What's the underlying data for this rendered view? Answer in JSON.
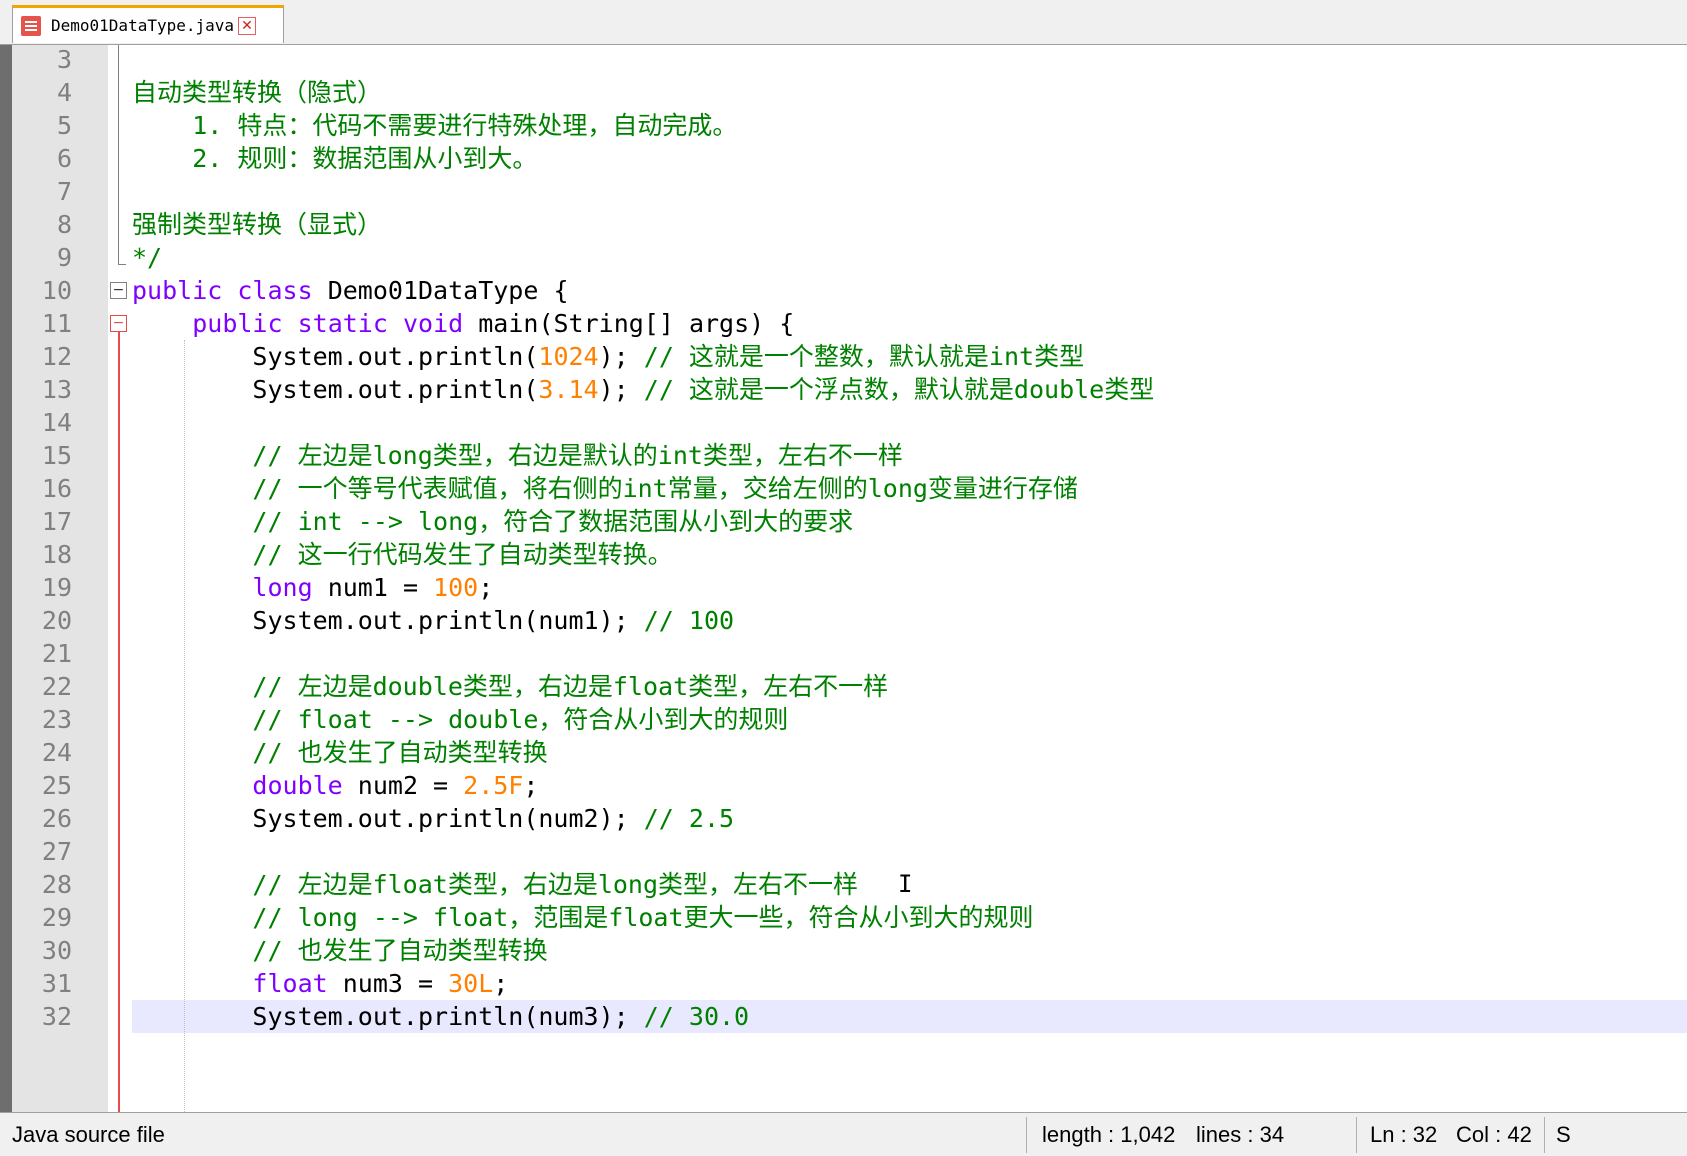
{
  "tab": {
    "filename": "Demo01DataType.java"
  },
  "colors": {
    "keyword": "#8000ff",
    "number": "#ff8000",
    "comment": "#008000",
    "line_number": "#808080",
    "current_line": "#e8e8ff",
    "fold_marker": "#e54c4c",
    "tab_accent": "#f2a500"
  },
  "editor": {
    "lines": [
      {
        "n": "3",
        "tokens": []
      },
      {
        "n": "4",
        "tokens": [
          {
            "t": "cm",
            "v": "自动类型转换（隐式）"
          }
        ]
      },
      {
        "n": "5",
        "tokens": [
          {
            "t": "cm",
            "v": "    1. 特点：代码不需要进行特殊处理，自动完成。"
          }
        ]
      },
      {
        "n": "6",
        "tokens": [
          {
            "t": "cm",
            "v": "    2. 规则：数据范围从小到大。"
          }
        ]
      },
      {
        "n": "7",
        "tokens": []
      },
      {
        "n": "8",
        "tokens": [
          {
            "t": "cm",
            "v": "强制类型转换（显式）"
          }
        ]
      },
      {
        "n": "9",
        "tokens": [
          {
            "t": "cm",
            "v": "*/"
          }
        ]
      },
      {
        "n": "10",
        "tokens": [
          {
            "t": "kw",
            "v": "public"
          },
          {
            "t": "tx",
            "v": " "
          },
          {
            "t": "kw",
            "v": "class"
          },
          {
            "t": "tx",
            "v": " Demo01DataType {"
          }
        ]
      },
      {
        "n": "11",
        "tokens": [
          {
            "t": "tx",
            "v": "    "
          },
          {
            "t": "kw",
            "v": "public"
          },
          {
            "t": "tx",
            "v": " "
          },
          {
            "t": "kw",
            "v": "static"
          },
          {
            "t": "tx",
            "v": " "
          },
          {
            "t": "kw",
            "v": "void"
          },
          {
            "t": "tx",
            "v": " main(String[] args) {"
          }
        ]
      },
      {
        "n": "12",
        "tokens": [
          {
            "t": "tx",
            "v": "        System.out.println("
          },
          {
            "t": "num",
            "v": "1024"
          },
          {
            "t": "tx",
            "v": "); "
          },
          {
            "t": "cm",
            "v": "// 这就是一个整数，默认就是int类型"
          }
        ]
      },
      {
        "n": "13",
        "tokens": [
          {
            "t": "tx",
            "v": "        System.out.println("
          },
          {
            "t": "num",
            "v": "3.14"
          },
          {
            "t": "tx",
            "v": "); "
          },
          {
            "t": "cm",
            "v": "// 这就是一个浮点数，默认就是double类型"
          }
        ]
      },
      {
        "n": "14",
        "tokens": []
      },
      {
        "n": "15",
        "tokens": [
          {
            "t": "cm",
            "v": "        // 左边是long类型，右边是默认的int类型，左右不一样"
          }
        ]
      },
      {
        "n": "16",
        "tokens": [
          {
            "t": "cm",
            "v": "        // 一个等号代表赋值，将右侧的int常量，交给左侧的long变量进行存储"
          }
        ]
      },
      {
        "n": "17",
        "tokens": [
          {
            "t": "cm",
            "v": "        // int --> long，符合了数据范围从小到大的要求"
          }
        ]
      },
      {
        "n": "18",
        "tokens": [
          {
            "t": "cm",
            "v": "        // 这一行代码发生了自动类型转换。"
          }
        ]
      },
      {
        "n": "19",
        "tokens": [
          {
            "t": "tx",
            "v": "        "
          },
          {
            "t": "kw",
            "v": "long"
          },
          {
            "t": "tx",
            "v": " num1 = "
          },
          {
            "t": "num",
            "v": "100"
          },
          {
            "t": "tx",
            "v": ";"
          }
        ]
      },
      {
        "n": "20",
        "tokens": [
          {
            "t": "tx",
            "v": "        System.out.println(num1); "
          },
          {
            "t": "cm",
            "v": "// 100"
          }
        ]
      },
      {
        "n": "21",
        "tokens": []
      },
      {
        "n": "22",
        "tokens": [
          {
            "t": "cm",
            "v": "        // 左边是double类型，右边是float类型，左右不一样"
          }
        ]
      },
      {
        "n": "23",
        "tokens": [
          {
            "t": "cm",
            "v": "        // float --> double，符合从小到大的规则"
          }
        ]
      },
      {
        "n": "24",
        "tokens": [
          {
            "t": "cm",
            "v": "        // 也发生了自动类型转换"
          }
        ]
      },
      {
        "n": "25",
        "tokens": [
          {
            "t": "tx",
            "v": "        "
          },
          {
            "t": "kw",
            "v": "double"
          },
          {
            "t": "tx",
            "v": " num2 = "
          },
          {
            "t": "num",
            "v": "2.5F"
          },
          {
            "t": "tx",
            "v": ";"
          }
        ]
      },
      {
        "n": "26",
        "tokens": [
          {
            "t": "tx",
            "v": "        System.out.println(num2); "
          },
          {
            "t": "cm",
            "v": "// 2.5"
          }
        ]
      },
      {
        "n": "27",
        "tokens": []
      },
      {
        "n": "28",
        "tokens": [
          {
            "t": "cm",
            "v": "        // 左边是float类型，右边是long类型，左右不一样"
          }
        ]
      },
      {
        "n": "29",
        "tokens": [
          {
            "t": "cm",
            "v": "        // long --> float，范围是float更大一些，符合从小到大的规则"
          }
        ]
      },
      {
        "n": "30",
        "tokens": [
          {
            "t": "cm",
            "v": "        // 也发生了自动类型转换"
          }
        ]
      },
      {
        "n": "31",
        "tokens": [
          {
            "t": "tx",
            "v": "        "
          },
          {
            "t": "kw",
            "v": "float"
          },
          {
            "t": "tx",
            "v": " num3 = "
          },
          {
            "t": "num",
            "v": "30L"
          },
          {
            "t": "tx",
            "v": ";"
          }
        ]
      },
      {
        "n": "32",
        "tokens": [
          {
            "t": "tx",
            "v": "        System.out.println(num3); "
          },
          {
            "t": "cm",
            "v": "// 30.0"
          }
        ],
        "current": true
      }
    ]
  },
  "statusbar": {
    "file_type": "Java source file",
    "length": "length : 1,042",
    "lines": "lines : 34",
    "ln": "Ln : 32",
    "col": "Col : 42",
    "extra": "S"
  }
}
